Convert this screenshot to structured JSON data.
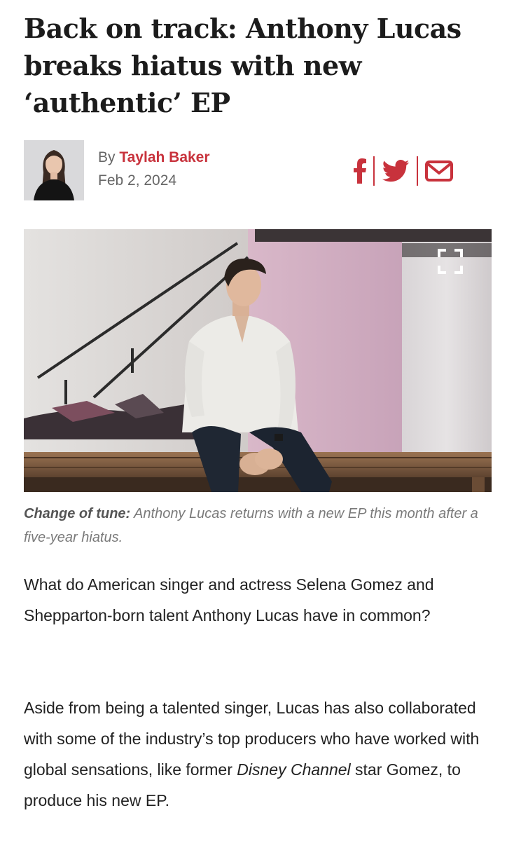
{
  "article": {
    "headline": "Back on track: Anthony Lucas breaks hiatus with new ‘authentic’ EP"
  },
  "byline": {
    "by_prefix": "By",
    "author": "Taylah Baker",
    "date": "Feb 2, 2024"
  },
  "share": {
    "icons": [
      "facebook-icon",
      "twitter-icon",
      "email-icon"
    ],
    "accent_color": "#c8323c"
  },
  "hero_image": {
    "expand_icon": "expand-icon"
  },
  "caption": {
    "label": "Change of tune:",
    "text": "Anthony Lucas returns with a new EP this month after a five-year hiatus."
  },
  "body": {
    "paragraph1": "What do American singer and actress Selena Gomez and Shepparton-born talent Anthony Lucas have in common?",
    "paragraph2_part1": "Aside from being a talented singer, Lucas has also collaborated with some of the industry’s top producers who have worked with global sensations, like former",
    "paragraph2_em": "Disney Channel",
    "paragraph2_part2": "star Gomez, to produce his new EP."
  }
}
